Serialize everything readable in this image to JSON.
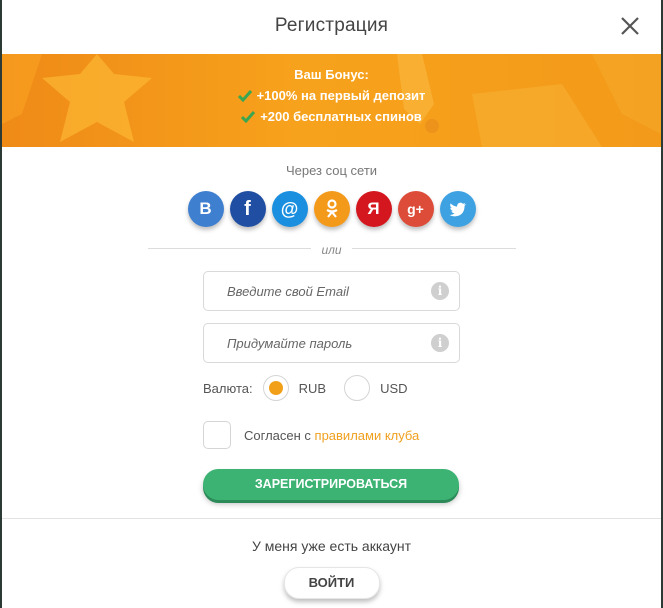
{
  "header": {
    "title": "Регистрация"
  },
  "banner": {
    "title": "Ваш Бонус:",
    "items": [
      {
        "highlight": "+100%",
        "text": " на первый депозит"
      },
      {
        "highlight": "+200",
        "text": " бесплатных спинов"
      }
    ]
  },
  "social": {
    "caption": "Через соц сети",
    "networks": [
      {
        "name": "vkontakte",
        "glyph": "B",
        "color": "#3f7fd0"
      },
      {
        "name": "facebook",
        "glyph": "f",
        "color": "#1f4ea3"
      },
      {
        "name": "mail-ru",
        "glyph": "@",
        "color": "#1a8fe0"
      },
      {
        "name": "odnoklassniki",
        "glyph": "ok",
        "color": "#f39a1a"
      },
      {
        "name": "yandex",
        "glyph": "Я",
        "color": "#d4171e"
      },
      {
        "name": "google-plus",
        "glyph": "g+",
        "color": "#dd4b39"
      },
      {
        "name": "twitter",
        "glyph": "tw",
        "color": "#3ea2e2"
      }
    ]
  },
  "divider": {
    "label": "или"
  },
  "form": {
    "email": {
      "placeholder": "Введите свой Email",
      "value": ""
    },
    "password": {
      "placeholder": "Придумайте пароль",
      "value": ""
    },
    "currency": {
      "label": "Валюта:",
      "options": [
        {
          "label": "RUB",
          "selected": true
        },
        {
          "label": "USD",
          "selected": false
        }
      ]
    },
    "agree": {
      "text": "Согласен с ",
      "link": "правилами клуба",
      "checked": false
    },
    "submit_label": "ЗАРЕГИСТРИРОВАТЬСЯ"
  },
  "footer": {
    "text": "У меня уже есть аккаунт",
    "login_label": "ВОЙТИ"
  },
  "colors": {
    "accent": "#f2a01a",
    "primary_button": "#3cb373",
    "banner": "#f39a1a"
  }
}
